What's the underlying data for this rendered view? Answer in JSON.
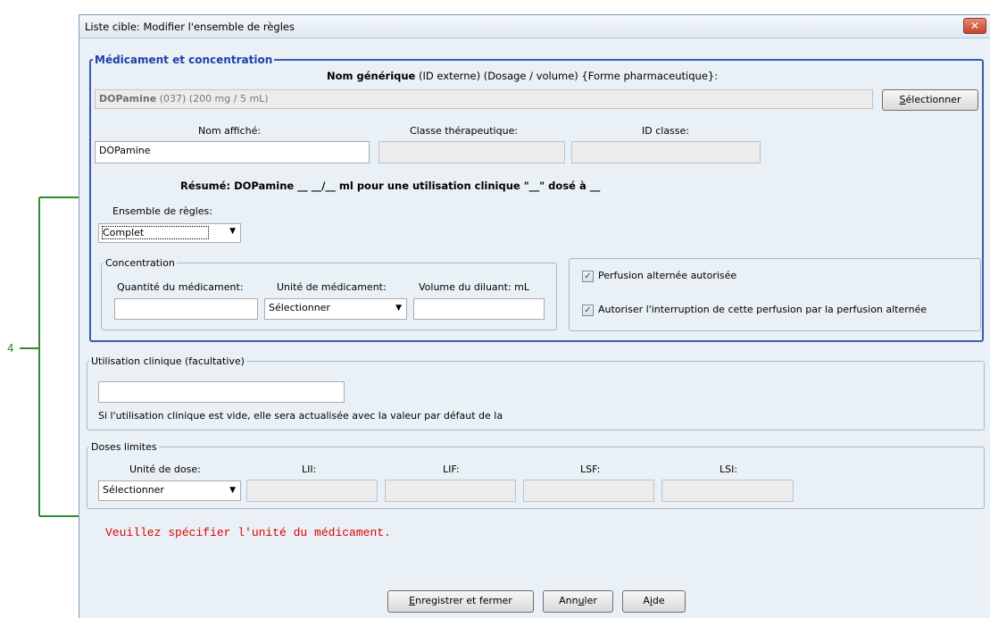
{
  "callout": {
    "label": "4"
  },
  "window": {
    "title": "Liste cible: Modifier l'ensemble de règles",
    "close_glyph": "✕"
  },
  "medication": {
    "legend": "Médicament et concentration",
    "generic_header_bold": "Nom générique",
    "generic_header_rest": "(ID externe) (Dosage / volume) {Forme pharmaceutique}:",
    "generic_value_bold": "DOPamine",
    "generic_value_rest": "(037) (200 mg / 5 mL)",
    "select_button_prefix": "S",
    "select_button_rest": "électionner",
    "display_name_label": "Nom affiché:",
    "display_name_value": "DOPamine",
    "therapeutic_class_label": "Classe thérapeutique:",
    "class_id_label": "ID classe:",
    "summary": "Résumé: DOPamine __ __/__ ml pour une utilisation clinique \"__\" dosé à __",
    "rule_set_label": "Ensemble de règles:",
    "rule_set_value": "Complet",
    "concentration": {
      "legend": "Concentration",
      "drug_quantity_label": "Quantité du médicament:",
      "drug_unit_label": "Unité de médicament:",
      "drug_unit_value": "Sélectionner",
      "diluent_volume_label": "Volume du diluant: mL"
    },
    "options": {
      "alt_infusion_label": "Perfusion alternée autorisée",
      "alt_infusion_checked": true,
      "allow_interrupt_label": "Autoriser l'interruption de cette perfusion par la perfusion alternée",
      "allow_interrupt_checked": true
    }
  },
  "clinical_use": {
    "legend": "Utilisation clinique (facultative)",
    "note": "Si l'utilisation clinique est vide, elle sera actualisée avec la valeur par défaut de la"
  },
  "dose_limits": {
    "legend": "Doses limites",
    "dose_unit_label": "Unité de dose:",
    "dose_unit_value": "Sélectionner",
    "lii_label": "LII:",
    "lif_label": "LIF:",
    "lsf_label": "LSF:",
    "lsi_label": "LSI:"
  },
  "error_message": "Veuillez spécifier l'unité du médicament.",
  "footer": {
    "save_prefix": "E",
    "save_rest": "nregistrer et fermer",
    "cancel_before": "Ann",
    "cancel_u": "u",
    "cancel_after": "ler",
    "help_before": "A",
    "help_u": "i",
    "help_after": "de"
  },
  "colors": {
    "callout_line": "#2e8b2e",
    "accent": "#1f3fa8",
    "error": "#e00000"
  }
}
